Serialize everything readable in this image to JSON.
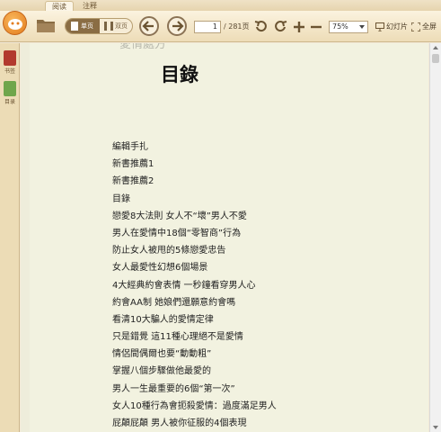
{
  "tabs": [
    {
      "label": "阅读",
      "active": true
    },
    {
      "label": "注释",
      "active": false
    }
  ],
  "toolbar": {
    "view_single": "单页",
    "view_double": "双页",
    "current_page": "1",
    "total_pages": "/ 281页",
    "zoom": "75%",
    "slideshow": "幻灯片",
    "fullscreen": "全屏"
  },
  "sidebar": {
    "bookmark": "书签",
    "toc": "目录"
  },
  "page": {
    "cut_heading": "愛情處方",
    "title": "目錄",
    "toc_items": [
      "編輯手扎",
      "新書推薦1",
      "新書推薦2",
      "目錄",
      "戀愛8大法則  女人不“壞”男人不愛",
      "男人在愛情中18個“零智商”行為",
      "防止女人被甩的5條戀愛忠告",
      "女人最愛性幻想6個場景",
      "4大經典約會表情  一秒鐘看穿男人心",
      "約會AA制  她娘們還願意約會嗎",
      "看清10大騙人的愛情定律",
      "只是錯覺  這11種心理絕不是愛情",
      "情侶間偶爾也要“動動粗”",
      "掌握八個步驟做他最愛的",
      "男人一生最重要的6個“第一次”",
      "女人10種行為會扼殺愛情：過度滿足男人",
      "屁顛屁顛  男人被你征服的4個表現"
    ]
  },
  "colors": {
    "accent": "#e27c1e",
    "toolbar_bg": "#f3e6c8",
    "page_bg": "#f2f2e0"
  }
}
